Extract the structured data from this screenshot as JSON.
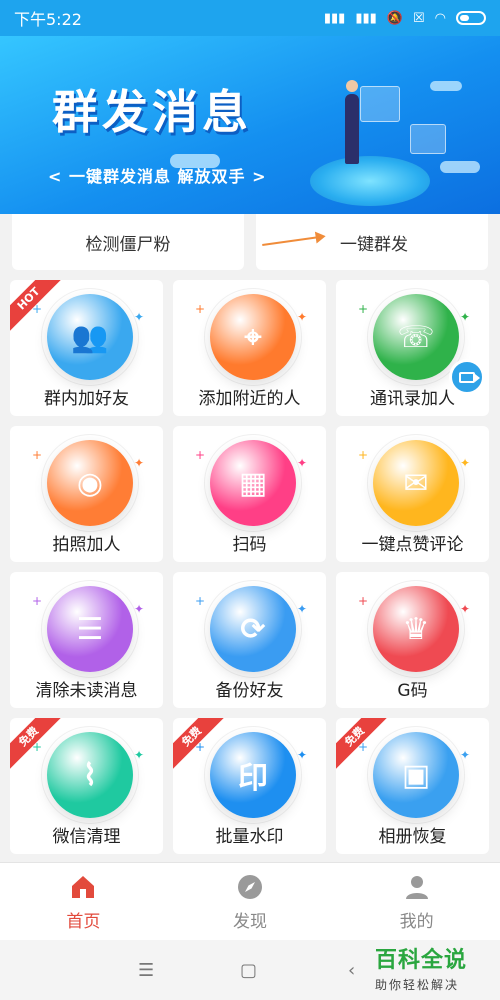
{
  "status_bar": {
    "time": "下午5:22"
  },
  "banner": {
    "title": "群发消息",
    "subtitle": "< 一键群发消息   解放双手 >"
  },
  "top_cards": [
    {
      "label": "检测僵尸粉"
    },
    {
      "label": "一键群发"
    }
  ],
  "features": [
    {
      "label": "群内加好友",
      "color": "#3aa8ef",
      "icon": "add-user-icon",
      "badge": "HOT"
    },
    {
      "label": "添加附近的人",
      "color": "#ff7a2d",
      "icon": "location-icon",
      "badge": ""
    },
    {
      "label": "通讯录加人",
      "color": "#2fb24a",
      "icon": "contacts-icon",
      "badge": ""
    },
    {
      "label": "拍照加人",
      "color": "#ff7d35",
      "icon": "camera-icon",
      "badge": ""
    },
    {
      "label": "扫码",
      "color": "#ff3f86",
      "icon": "qr-scan-icon",
      "badge": ""
    },
    {
      "label": "一键点赞评论",
      "color": "#ffb61e",
      "icon": "comment-icon",
      "badge": ""
    },
    {
      "label": "清除未读消息",
      "color": "#b161e8",
      "icon": "message-icon",
      "badge": ""
    },
    {
      "label": "备份好友",
      "color": "#3a9cf2",
      "icon": "backup-icon",
      "badge": ""
    },
    {
      "label": "G码",
      "color": "#ef4a52",
      "icon": "crown-icon",
      "badge": ""
    },
    {
      "label": "微信清理",
      "color": "#1fc9a0",
      "icon": "broom-icon",
      "badge": "免费"
    },
    {
      "label": "批量水印",
      "color": "#1e8ff0",
      "icon": "stamp-icon",
      "badge": "免费"
    },
    {
      "label": "相册恢复",
      "color": "#3aa0f0",
      "icon": "photo-icon",
      "badge": "免费"
    }
  ],
  "tabbar": [
    {
      "label": "首页",
      "icon": "home-icon",
      "active": true
    },
    {
      "label": "发现",
      "icon": "compass-icon",
      "active": false
    },
    {
      "label": "我的",
      "icon": "profile-icon",
      "active": false
    }
  ],
  "watermark": {
    "title": "百科全说",
    "subtitle": "助你轻松解决"
  }
}
